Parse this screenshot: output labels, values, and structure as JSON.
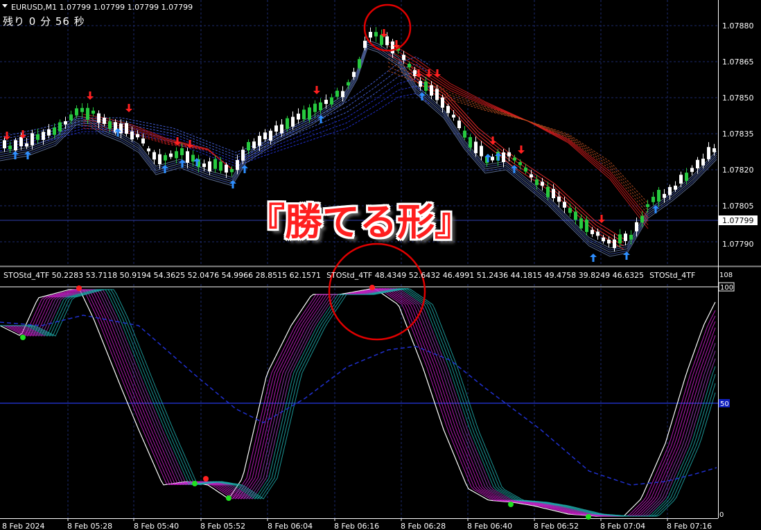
{
  "header": {
    "symbol_line": "EURUSD,M1  1.07799 1.07799 1.07799 1.07799",
    "timer_text": "残り 0 分 56 秒"
  },
  "overlay_text": "『勝てる形』",
  "price_axis": {
    "labels": [
      "1.07880",
      "1.07865",
      "1.07850",
      "1.07835",
      "1.07820",
      "1.07805",
      "1.07790"
    ],
    "current_price": "1.07799"
  },
  "indicator": {
    "name": "STOStd_4TF",
    "label_groups": [
      "STOStd_4TF 50.2283 53.7118 50.9194 54.3625 52.0476 54.9966 28.8515 62.1571",
      "STOStd_4TF 48.4349 52.6432 46.4991 51.2436 44.1815 49.4758 39.8249 46.6325",
      "STOStd_4TF"
    ],
    "scale_labels": [
      "108",
      "100",
      "50",
      "0"
    ]
  },
  "time_axis": {
    "labels": [
      "8 Feb 2024",
      "8 Feb 05:28",
      "8 Feb 05:40",
      "8 Feb 05:52",
      "8 Feb 06:04",
      "8 Feb 06:16",
      "8 Feb 06:28",
      "8 Feb 06:40",
      "8 Feb 06:52",
      "8 Feb 07:04",
      "8 Feb 07:16"
    ]
  },
  "colors": {
    "background": "#000000",
    "grid": "#1c2a6e",
    "bull_candle": "#27c93f",
    "bear_candle": "#ffffff",
    "sell_arrow": "#ff2020",
    "buy_arrow": "#2e8fff",
    "circle_highlight": "#e00000",
    "sto_magenta": "#d020d0",
    "sto_teal": "#20b0b0"
  },
  "icons": [
    "dropdown-triangle-icon",
    "sell-arrow-icon",
    "buy-arrow-icon"
  ]
}
